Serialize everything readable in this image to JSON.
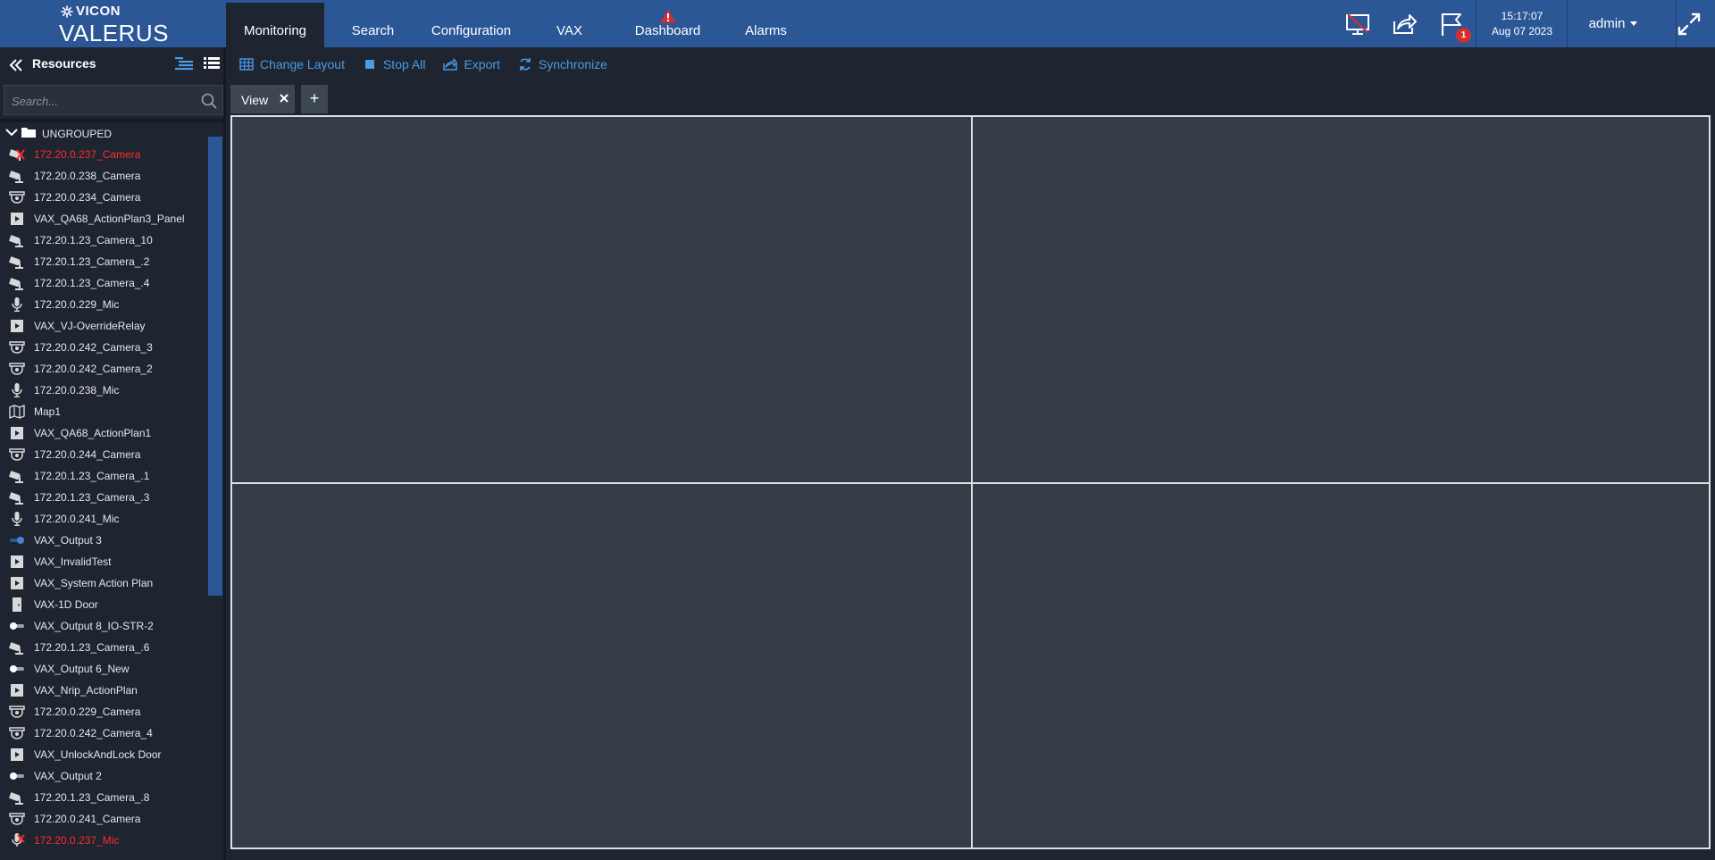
{
  "app": {
    "brand": "VICON",
    "product": "VALERUS"
  },
  "nav": {
    "tabs": [
      {
        "label": "Monitoring",
        "active": true
      },
      {
        "label": "Search"
      },
      {
        "label": "Configuration"
      },
      {
        "label": "VAX"
      },
      {
        "label": "Dashboard",
        "alert_icon": "warning-icon"
      },
      {
        "label": "Alarms"
      }
    ],
    "icons": [
      "monitor-off-icon",
      "share-icon",
      "flag-icon"
    ],
    "flag_badge": "1",
    "badge_color": "#d32f2f",
    "clock": {
      "time": "15:17:07",
      "date": "Aug 07 2023"
    },
    "user": "admin"
  },
  "sidebar": {
    "title": "Resources",
    "search_placeholder": "Search...",
    "group": "UNGROUPED",
    "items": [
      {
        "label": "172.20.0.237_Camera",
        "icon": "camera-disabled-icon",
        "status": "error"
      },
      {
        "label": "172.20.0.238_Camera",
        "icon": "bullet-camera-icon"
      },
      {
        "label": "172.20.0.234_Camera",
        "icon": "dome-camera-icon"
      },
      {
        "label": "VAX_QA68_ActionPlan3_Panel",
        "icon": "action-plan-icon"
      },
      {
        "label": "172.20.1.23_Camera_10",
        "icon": "bullet-camera-icon"
      },
      {
        "label": "172.20.1.23_Camera_.2",
        "icon": "bullet-camera-icon"
      },
      {
        "label": "172.20.1.23_Camera_.4",
        "icon": "bullet-camera-icon"
      },
      {
        "label": "172.20.0.229_Mic",
        "icon": "microphone-icon"
      },
      {
        "label": "VAX_VJ-OverrideRelay",
        "icon": "action-plan-icon"
      },
      {
        "label": "172.20.0.242_Camera_3",
        "icon": "dome-camera-icon"
      },
      {
        "label": "172.20.0.242_Camera_2",
        "icon": "dome-camera-icon"
      },
      {
        "label": "172.20.0.238_Mic",
        "icon": "microphone-icon"
      },
      {
        "label": "Map1",
        "icon": "map-icon"
      },
      {
        "label": "VAX_QA68_ActionPlan1",
        "icon": "action-plan-icon"
      },
      {
        "label": "172.20.0.244_Camera",
        "icon": "dome-camera-icon"
      },
      {
        "label": "172.20.1.23_Camera_.1",
        "icon": "bullet-camera-icon"
      },
      {
        "label": "172.20.1.23_Camera_.3",
        "icon": "bullet-camera-icon"
      },
      {
        "label": "172.20.0.241_Mic",
        "icon": "microphone-icon"
      },
      {
        "label": "VAX_Output 3",
        "icon": "toggle-on-icon"
      },
      {
        "label": "VAX_InvalidTest",
        "icon": "action-plan-icon"
      },
      {
        "label": "VAX_System Action Plan",
        "icon": "action-plan-icon"
      },
      {
        "label": "VAX-1D Door",
        "icon": "door-icon"
      },
      {
        "label": "VAX_Output 8_IO-STR-2",
        "icon": "toggle-off-icon"
      },
      {
        "label": "172.20.1.23_Camera_.6",
        "icon": "bullet-camera-icon"
      },
      {
        "label": "VAX_Output 6_New",
        "icon": "toggle-off-icon"
      },
      {
        "label": "VAX_Nrip_ActionPlan",
        "icon": "action-plan-icon"
      },
      {
        "label": "172.20.0.229_Camera",
        "icon": "dome-camera-icon"
      },
      {
        "label": "172.20.0.242_Camera_4",
        "icon": "dome-camera-icon"
      },
      {
        "label": "VAX_UnlockAndLock Door",
        "icon": "action-plan-icon"
      },
      {
        "label": "VAX_Output 2",
        "icon": "toggle-off-icon"
      },
      {
        "label": "172.20.1.23_Camera_.8",
        "icon": "bullet-camera-icon"
      },
      {
        "label": "172.20.0.241_Camera",
        "icon": "dome-camera-icon"
      },
      {
        "label": "172.20.0.237_Mic",
        "icon": "microphone-disabled-icon",
        "status": "error"
      }
    ]
  },
  "toolbar": {
    "change_layout": "Change Layout",
    "stop_all": "Stop All",
    "export": "Export",
    "synchronize": "Synchronize"
  },
  "view": {
    "tab_label": "View",
    "add_label": "+",
    "layout": "2x2"
  },
  "colors": {
    "nav_bg": "#2b5797",
    "page_bg": "#1e2530",
    "tile_bg": "#343c47",
    "link": "#4a9be8",
    "error": "#ff2a2a"
  }
}
